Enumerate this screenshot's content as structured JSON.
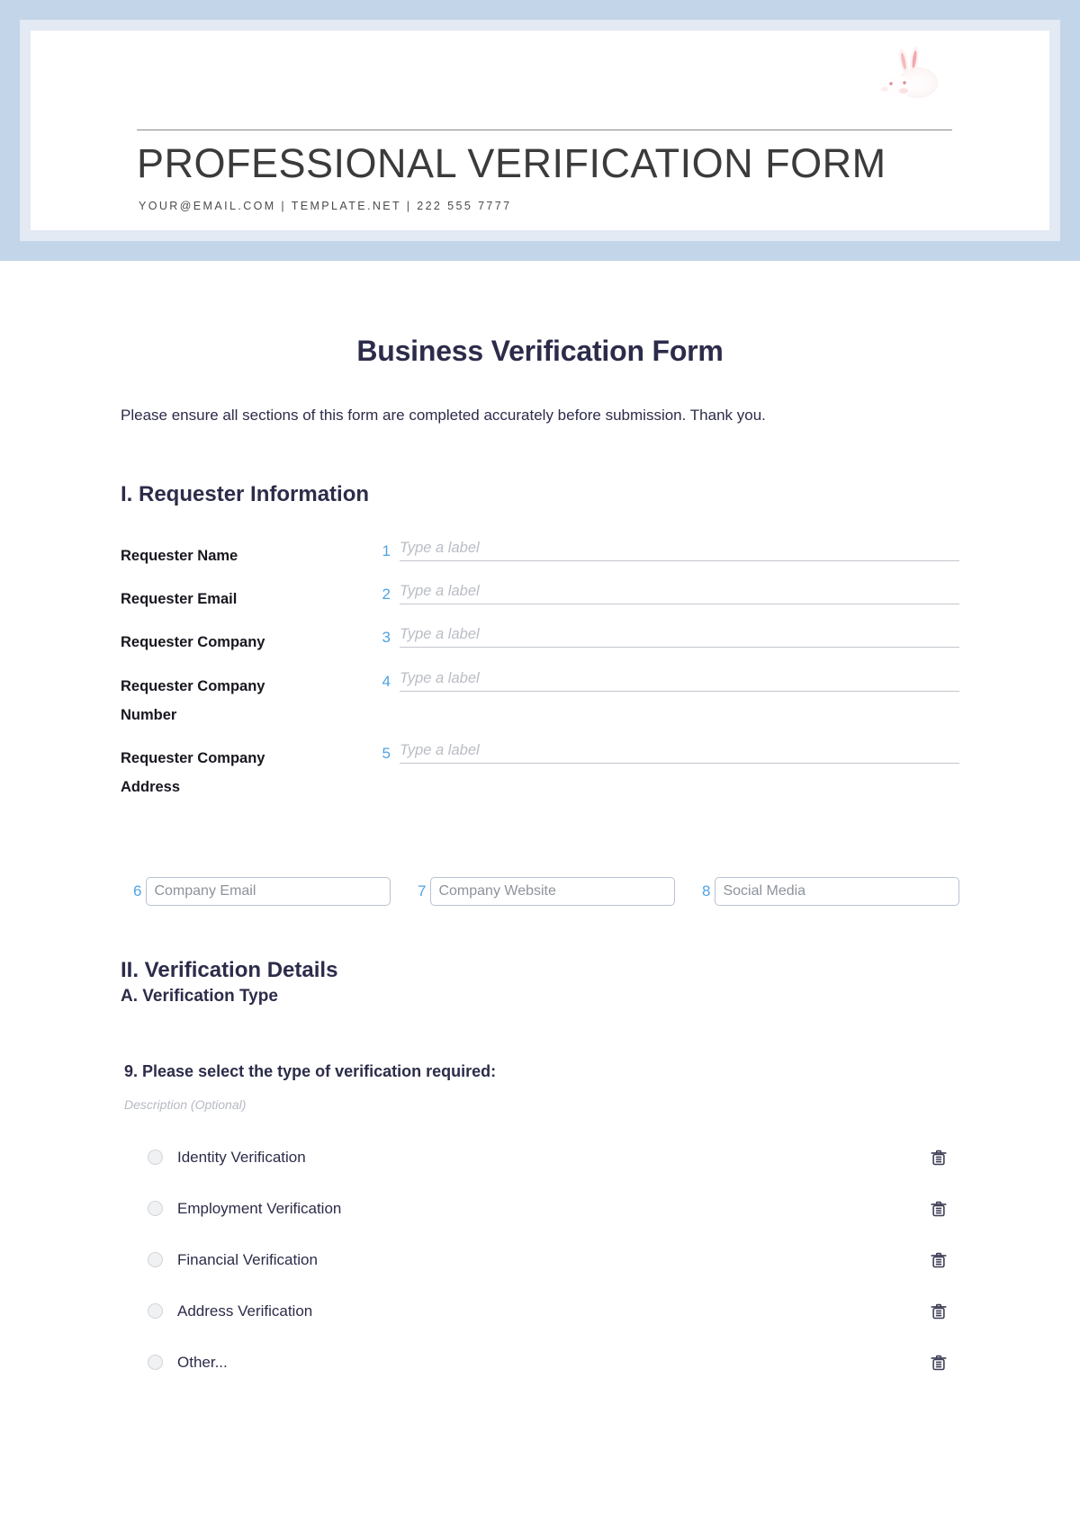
{
  "letterhead": {
    "logo_alt": "rabbit-logo",
    "title": "PROFESSIONAL VERIFICATION FORM",
    "contact": "YOUR@EMAIL.COM | TEMPLATE.NET | 222 555 7777"
  },
  "document": {
    "title": "Business Verification Form",
    "intro": "Please ensure all sections of this form are completed accurately before submission. Thank you."
  },
  "sections": {
    "requester": {
      "heading": "I. Requester Information",
      "fields": [
        {
          "num": "1",
          "label": "Requester Name",
          "placeholder": "Type a label"
        },
        {
          "num": "2",
          "label": "Requester Email",
          "placeholder": "Type a label"
        },
        {
          "num": "3",
          "label": "Requester Company",
          "placeholder": "Type a label"
        },
        {
          "num": "4",
          "label": "Requester Company Number",
          "placeholder": "Type a label"
        },
        {
          "num": "5",
          "label": "Requester Company Address",
          "placeholder": "Type a label"
        }
      ],
      "boxes": [
        {
          "num": "6",
          "placeholder": "Company Email"
        },
        {
          "num": "7",
          "placeholder": "Company Website"
        },
        {
          "num": "8",
          "placeholder": "Social Media"
        }
      ]
    },
    "verification": {
      "heading": "II. Verification Details",
      "subheading": "A. Verification Type",
      "question": "9. Please select the type of verification required:",
      "description": "Description (Optional)",
      "options": [
        {
          "label": "Identity Verification",
          "delete_icon": "trash-icon"
        },
        {
          "label": "Employment Verification",
          "delete_icon": "trash-icon"
        },
        {
          "label": "Financial Verification",
          "delete_icon": "trash-icon"
        },
        {
          "label": "Address Verification",
          "delete_icon": "trash-icon"
        },
        {
          "label": "Other...",
          "delete_icon": "trash-icon"
        }
      ]
    }
  },
  "colors": {
    "accent_blue": "#4fa3e3",
    "border_blue": "#c3d5e8",
    "border_blue_light": "#e3eaf4",
    "heading": "#2c2c4a"
  }
}
